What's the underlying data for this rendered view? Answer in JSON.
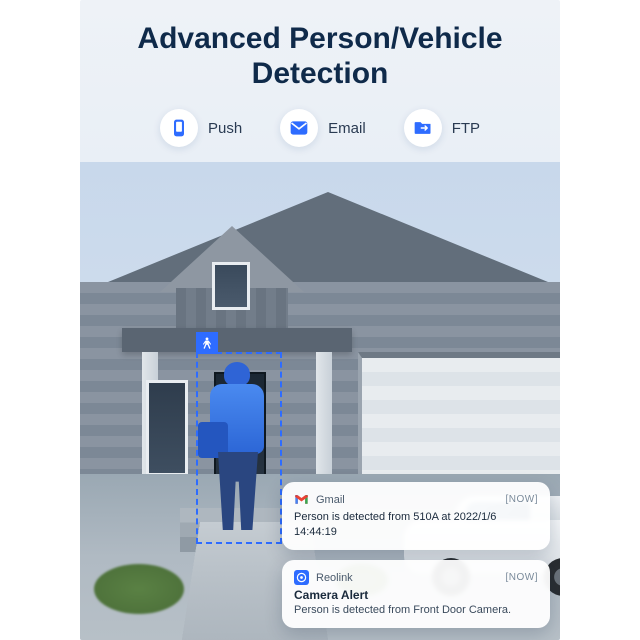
{
  "headline": "Advanced Person/Vehicle Detection",
  "features": {
    "push": {
      "label": "Push"
    },
    "email": {
      "label": "Email"
    },
    "ftp": {
      "label": "FTP"
    }
  },
  "notifications": {
    "gmail": {
      "app": "Gmail",
      "time": "[NOW]",
      "body": "Person is detected from 510A at 2022/1/6 14:44:19"
    },
    "reolink": {
      "app": "Reolink",
      "time": "[NOW]",
      "title": "Camera Alert",
      "body": "Person is detected from Front Door Camera."
    }
  }
}
